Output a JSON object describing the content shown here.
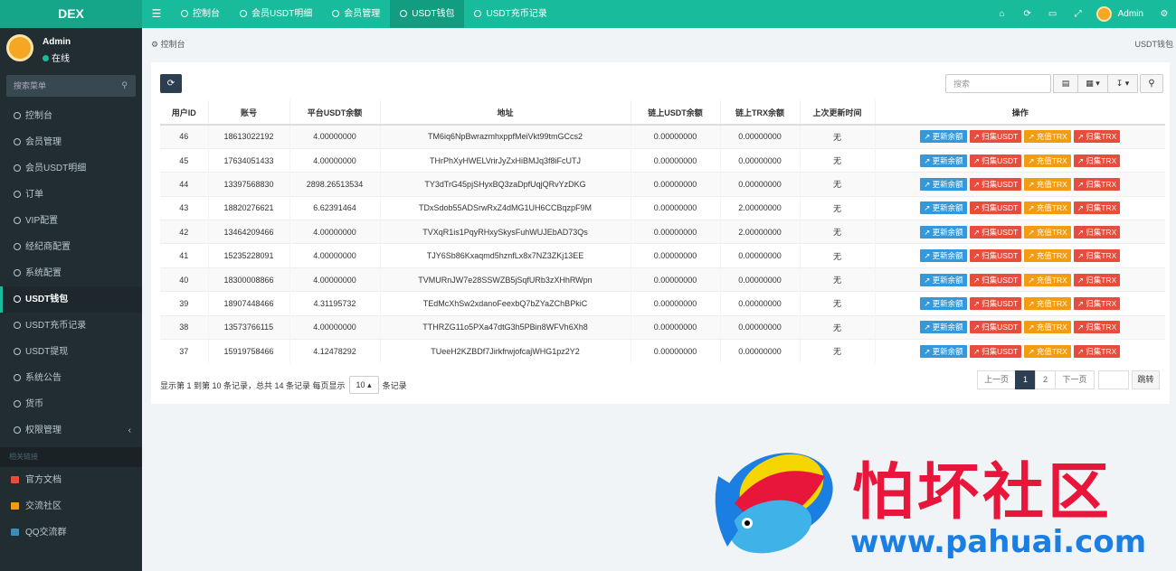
{
  "topbar": {
    "brand": "DEX",
    "tabs": [
      {
        "label": "控制台",
        "active": false
      },
      {
        "label": "会员USDT明细",
        "active": false
      },
      {
        "label": "会员管理",
        "active": false
      },
      {
        "label": "USDT钱包",
        "active": true
      },
      {
        "label": "USDT充币记录",
        "active": false
      }
    ],
    "username": "Admin"
  },
  "sidebar": {
    "user": {
      "name": "Admin",
      "status": "在线"
    },
    "search_placeholder": "搜索菜单",
    "items": [
      {
        "label": "控制台"
      },
      {
        "label": "会员管理"
      },
      {
        "label": "会员USDT明细"
      },
      {
        "label": "订单"
      },
      {
        "label": "VIP配置"
      },
      {
        "label": "经纪商配置"
      },
      {
        "label": "系统配置"
      },
      {
        "label": "USDT钱包"
      },
      {
        "label": "USDT充币记录"
      },
      {
        "label": "USDT提现"
      },
      {
        "label": "系统公告"
      },
      {
        "label": "货币"
      },
      {
        "label": "权限管理"
      }
    ],
    "section_header": "相关链接",
    "links": [
      {
        "label": "官方文档",
        "color": "#e74c3c"
      },
      {
        "label": "交流社区",
        "color": "#f39c12"
      },
      {
        "label": "QQ交流群",
        "color": "#3c8dbc"
      }
    ]
  },
  "content": {
    "breadcrumb": "控制台",
    "page_title": "USDT钱包",
    "search_placeholder": "搜索",
    "table": {
      "headers": [
        "用户ID",
        "账号",
        "平台USDT余额",
        "地址",
        "链上USDT余额",
        "链上TRX余额",
        "上次更新时间",
        "操作"
      ],
      "rows": [
        [
          "46",
          "18613022192",
          "4.00000000",
          "TM6iq6NpBwrazmhxppfMeiVkt99tmGCcs2",
          "0.00000000",
          "0.00000000",
          "无"
        ],
        [
          "45",
          "17634051433",
          "4.00000000",
          "THrPhXyHWELVrirJyZxHiBMJq3f8iFcUTJ",
          "0.00000000",
          "0.00000000",
          "无"
        ],
        [
          "44",
          "13397568830",
          "2898.26513534",
          "TY3dTrG45pjSHyxBQ3zaDpfUqjQRvYzDKG",
          "0.00000000",
          "0.00000000",
          "无"
        ],
        [
          "43",
          "18820276621",
          "6.62391464",
          "TDxSdob55ADSrwRxZ4dMG1UH6CCBqzpF9M",
          "0.00000000",
          "2.00000000",
          "无"
        ],
        [
          "42",
          "13464209466",
          "4.00000000",
          "TVXqR1is1PqyRHxySkysFuhWUJEbAD73Qs",
          "0.00000000",
          "2.00000000",
          "无"
        ],
        [
          "41",
          "15235228091",
          "4.00000000",
          "TJY6Sb86Kxaqmd5hznfLx8x7NZ3ZKj13EE",
          "0.00000000",
          "0.00000000",
          "无"
        ],
        [
          "40",
          "18300008866",
          "4.00000000",
          "TVMURnJW7e28SSWZB5jSqfURb3zXHhRWpn",
          "0.00000000",
          "0.00000000",
          "无"
        ],
        [
          "39",
          "18907448466",
          "4.31195732",
          "TEdMcXhSw2xdanoFeexbQ7bZYaZChBPkiC",
          "0.00000000",
          "0.00000000",
          "无"
        ],
        [
          "38",
          "13573766115",
          "4.00000000",
          "TTHRZG11o5PXa47dtG3h5PBin8WFVh6Xh8",
          "0.00000000",
          "0.00000000",
          "无"
        ],
        [
          "37",
          "15919758466",
          "4.12478292",
          "TUeeH2KZBDf7JirkfrwjofcajWHG1pz2Y2",
          "0.00000000",
          "0.00000000",
          "无"
        ]
      ],
      "actions": [
        "更新余额",
        "归集USDT",
        "充值TRX",
        "归集TRX"
      ]
    },
    "pagination": {
      "info_prefix": "显示第 1 到第 10 条记录，总共 14 条记录 每页显示",
      "page_size": "10",
      "info_suffix": "条记录",
      "prev": "上一页",
      "pages": [
        "1",
        "2"
      ],
      "current": "1",
      "next": "下一页",
      "jump": "跳转"
    }
  },
  "watermark": {
    "text": "怕坏社区",
    "url": "www.pahuai.com"
  }
}
